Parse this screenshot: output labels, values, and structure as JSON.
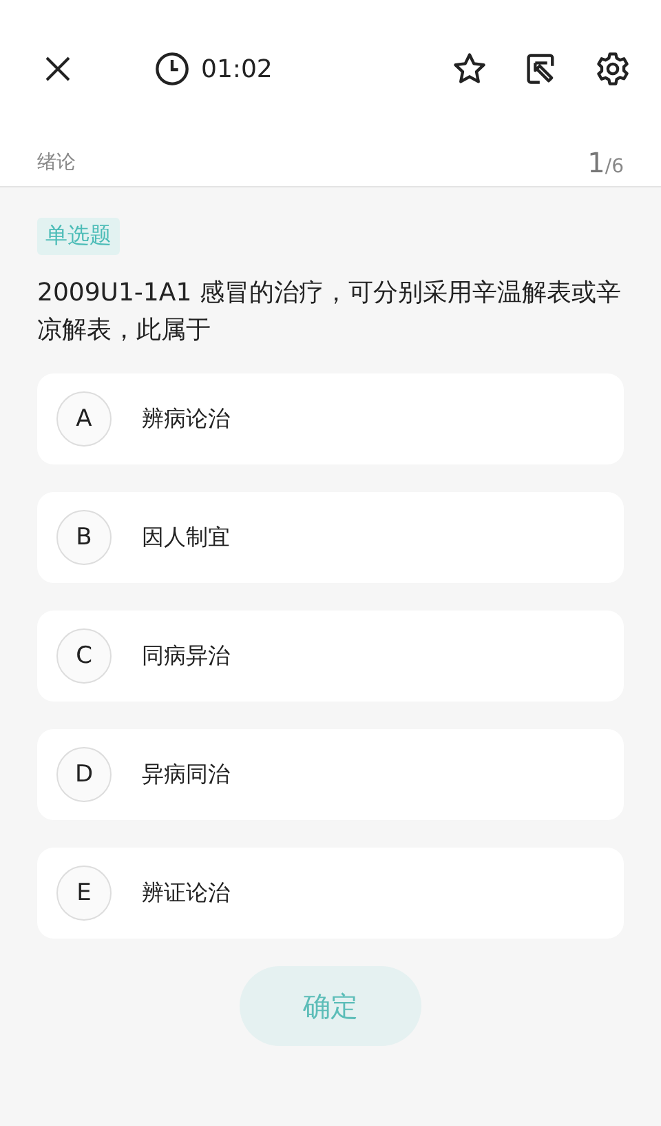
{
  "top_bar": {
    "timer": "01:02"
  },
  "chapter": {
    "title": "绪论",
    "current": "1",
    "total": "/6"
  },
  "question": {
    "type_tag": "单选题",
    "text": "2009U1-1A1 感冒的治疗，可分别采用辛温解表或辛凉解表，此属于"
  },
  "options": [
    {
      "letter": "A",
      "text": "辨病论治",
      "selected": false
    },
    {
      "letter": "B",
      "text": "因人制宜",
      "selected": false
    },
    {
      "letter": "C",
      "text": "同病异治",
      "selected": false
    },
    {
      "letter": "D",
      "text": "异病同治",
      "selected": false
    },
    {
      "letter": "E",
      "text": "辨证论治",
      "selected": false
    }
  ],
  "confirm_button": {
    "label": "确定",
    "disabled": true
  }
}
